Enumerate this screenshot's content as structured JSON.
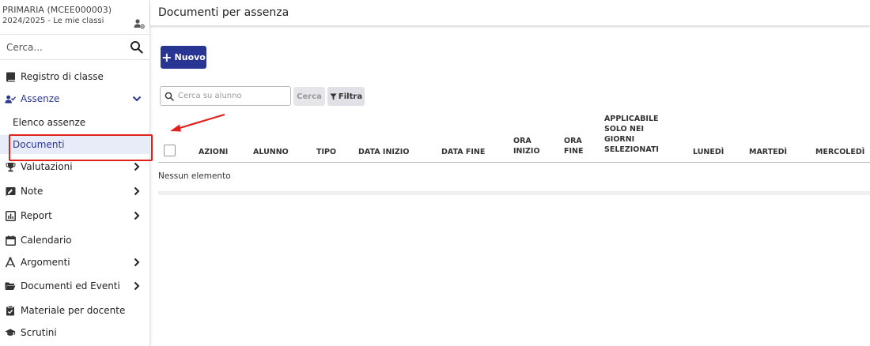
{
  "school": {
    "name": "PRIMARIA (MCEE000003)",
    "year": "2024/2025 - Le mie classi"
  },
  "sidebar_search": {
    "placeholder": "Cerca..."
  },
  "nav": [
    {
      "label": "Registro di classe",
      "icon": "book-icon"
    },
    {
      "label": "Assenze",
      "icon": "user-check-icon",
      "expanded": true
    },
    {
      "label": "Valutazioni",
      "icon": "trophy-icon"
    },
    {
      "label": "Note",
      "icon": "note-icon"
    },
    {
      "label": "Report",
      "icon": "chart-icon"
    },
    {
      "label": "Calendario",
      "icon": "calendar-icon"
    },
    {
      "label": "Argomenti",
      "icon": "compass-icon"
    },
    {
      "label": "Documenti ed Eventi",
      "icon": "folder-icon"
    },
    {
      "label": "Materiale per docente",
      "icon": "clipboard-icon"
    },
    {
      "label": "Scrutini",
      "icon": "graduation-cap-icon"
    }
  ],
  "subnav": [
    {
      "label": "Elenco assenze"
    },
    {
      "label": "Documenti",
      "selected": true
    }
  ],
  "header": {
    "title": "Documenti per assenza"
  },
  "toolbar": {
    "new_label": "Nuovo",
    "search_placeholder": "Cerca su alunno",
    "search_label": "Cerca",
    "filter_label": "Filtra"
  },
  "table": {
    "columns": [
      "AZIONI",
      "ALUNNO",
      "TIPO",
      "DATA INIZIO",
      "DATA FINE",
      "ORA INIZIO",
      "ORA FINE",
      "APPLICABILE SOLO NEI GIORNI SELEZIONATI",
      "LUNEDÌ",
      "MARTEDÌ",
      "MERCOLEDÌ"
    ],
    "empty_text": "Nessun elemento"
  },
  "colors": {
    "primary": "#283593",
    "annotation": "#e0211d",
    "selected_bg": "#e8ebf8"
  }
}
